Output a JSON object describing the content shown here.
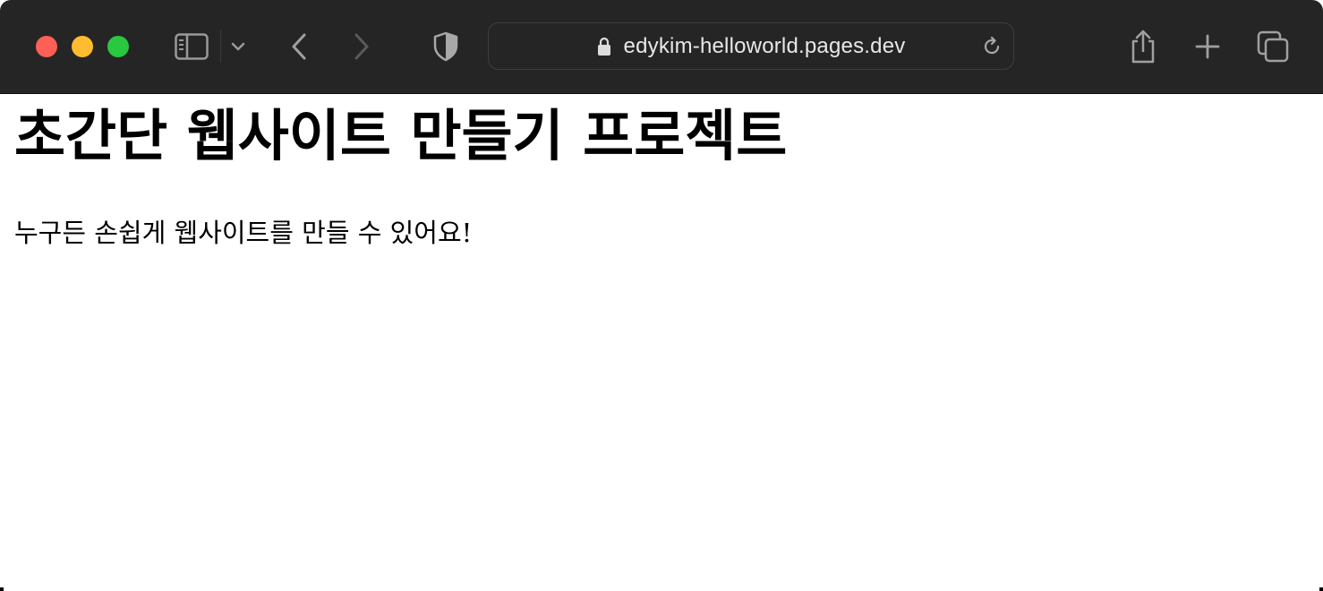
{
  "browser": {
    "address_bar": {
      "url": "edykim-helloworld.pages.dev"
    },
    "icons": {
      "sidebar": "sidebar-icon",
      "chevron": "chevron-down-icon",
      "back": "back-arrow-icon",
      "forward": "forward-arrow-icon",
      "privacy": "shield-icon",
      "lock": "lock-icon",
      "reload": "reload-icon",
      "share": "share-icon",
      "new_tab": "plus-icon",
      "tabs": "tab-overview-icon"
    },
    "colors": {
      "toolbar": "#252525",
      "close": "#fe5f57",
      "minimize": "#febc2e",
      "zoom": "#28c840"
    }
  },
  "page": {
    "title": "초간단 웹사이트 만들기 프로젝트",
    "description": "누구든 손쉽게 웹사이트를 만들 수 있어요!"
  }
}
